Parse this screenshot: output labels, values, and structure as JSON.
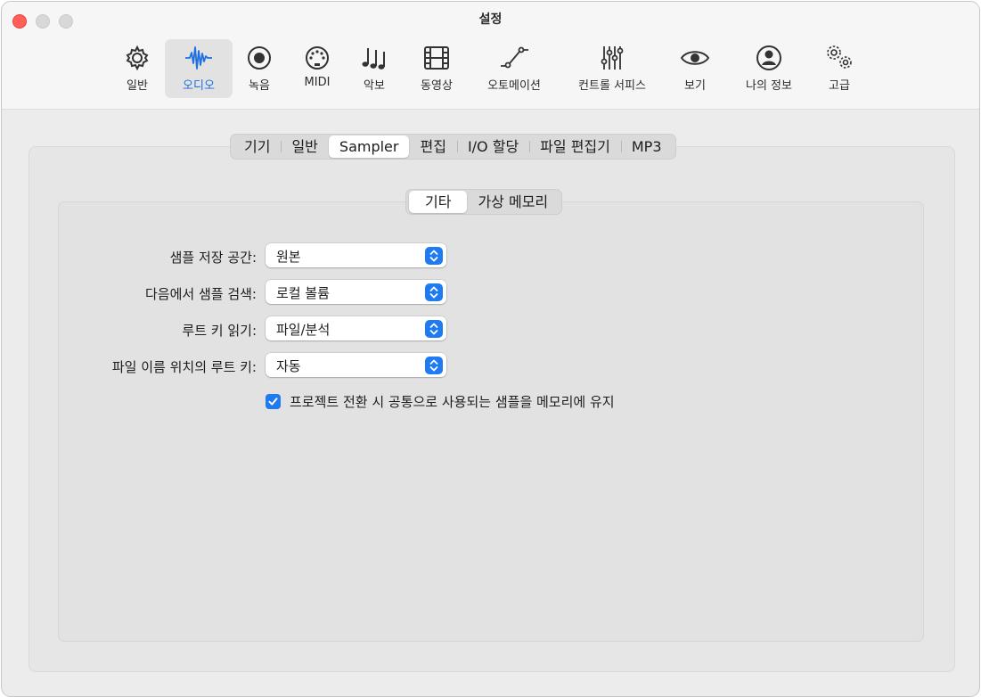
{
  "window": {
    "title": "설정"
  },
  "toolbar": {
    "items": [
      {
        "label": "일반",
        "icon": "gear-icon"
      },
      {
        "label": "오디오",
        "icon": "waveform-icon",
        "active": true
      },
      {
        "label": "녹음",
        "icon": "record-icon"
      },
      {
        "label": "MIDI",
        "icon": "midi-port-icon"
      },
      {
        "label": "악보",
        "icon": "music-notes-icon"
      },
      {
        "label": "동영상",
        "icon": "film-icon"
      },
      {
        "label": "오토메이션",
        "icon": "automation-curve-icon"
      },
      {
        "label": "컨트롤 서피스",
        "icon": "faders-icon"
      },
      {
        "label": "보기",
        "icon": "eye-icon"
      },
      {
        "label": "나의 정보",
        "icon": "person-icon"
      },
      {
        "label": "고급",
        "icon": "gears-icon"
      }
    ]
  },
  "tabs": [
    {
      "label": "기기"
    },
    {
      "label": "일반"
    },
    {
      "label": "Sampler",
      "selected": true
    },
    {
      "label": "편집"
    },
    {
      "label": "I/O 할당"
    },
    {
      "label": "파일 편집기"
    },
    {
      "label": "MP3"
    }
  ],
  "subtabs": [
    {
      "label": "기타",
      "selected": true
    },
    {
      "label": "가상 메모리"
    }
  ],
  "form": {
    "rows": [
      {
        "label": "샘플 저장 공간:",
        "value": "원본"
      },
      {
        "label": "다음에서 샘플 검색:",
        "value": "로컬 볼륨"
      },
      {
        "label": "루트 키 읽기:",
        "value": "파일/분석"
      },
      {
        "label": "파일 이름 위치의 루트 키:",
        "value": "자동"
      }
    ],
    "checkbox": {
      "label": "프로젝트 전환 시 공통으로 사용되는 샘플을 메모리에 유지",
      "checked": true
    }
  },
  "colors": {
    "accent": "#1f7bf2",
    "close": "#ff5f57"
  }
}
